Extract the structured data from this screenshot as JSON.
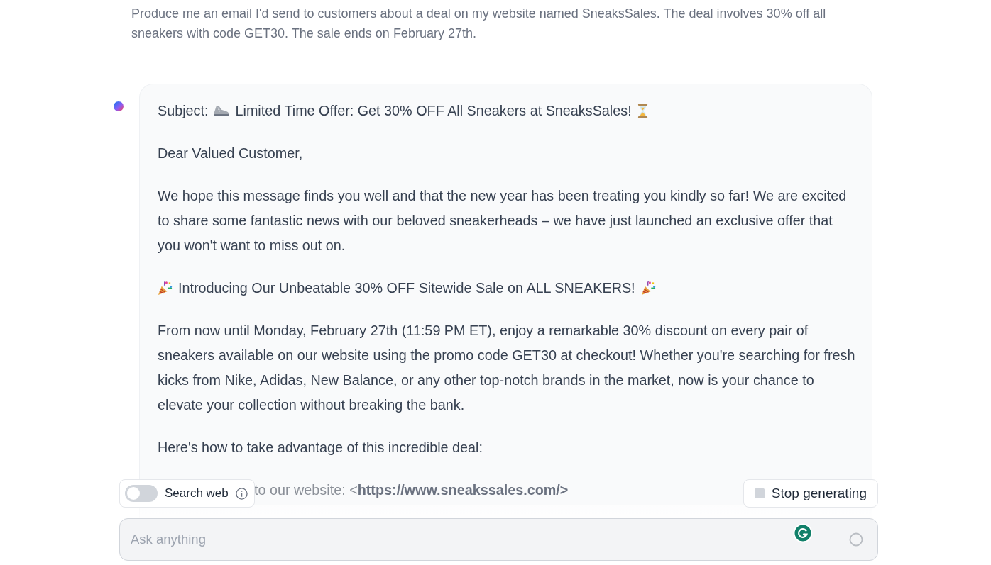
{
  "user_message": {
    "text": "Produce me an email I'd send to customers about a deal on my website named SneaksSales. The deal involves 30% off all sneakers with code GET30. The sale ends on February 27th."
  },
  "reply": {
    "paragraphs": [
      {
        "kind": "subject",
        "label": "Subject:",
        "text": "Limited Time Offer: Get 30% OFF All Sneakers at SneaksSales!"
      },
      {
        "kind": "text",
        "text": "Dear Valued Customer,"
      },
      {
        "kind": "text",
        "text": "We hope this message finds you well and that the new year has been treating you kindly so far! We are excited to share some fantastic news with our beloved sneakerheads – we have just launched an exclusive offer that you won't want to miss out on."
      },
      {
        "kind": "banner",
        "text": "Introducing Our Unbeatable 30% OFF Sitewide Sale on ALL SNEAKERS!"
      },
      {
        "kind": "text",
        "text": "From now until Monday, February 27th (11:59 PM ET), enjoy a remarkable 30% discount on every pair of sneakers available on our website using the promo code GET30 at checkout! Whether you're searching for fresh kicks from Nike, Adidas, New Balance, or any other top-notch brands in the market, now is your chance to elevate your collection without breaking the bank."
      },
      {
        "kind": "text",
        "text": "Here's how to take advantage of this incredible deal:"
      },
      {
        "kind": "list_item",
        "text": "to our website: <",
        "link": "https://www.sneakssales.com/>"
      }
    ]
  },
  "search_web": {
    "label": "Search web",
    "on": false
  },
  "stop_button": {
    "label": "Stop generating"
  },
  "input": {
    "placeholder": "Ask anything"
  }
}
